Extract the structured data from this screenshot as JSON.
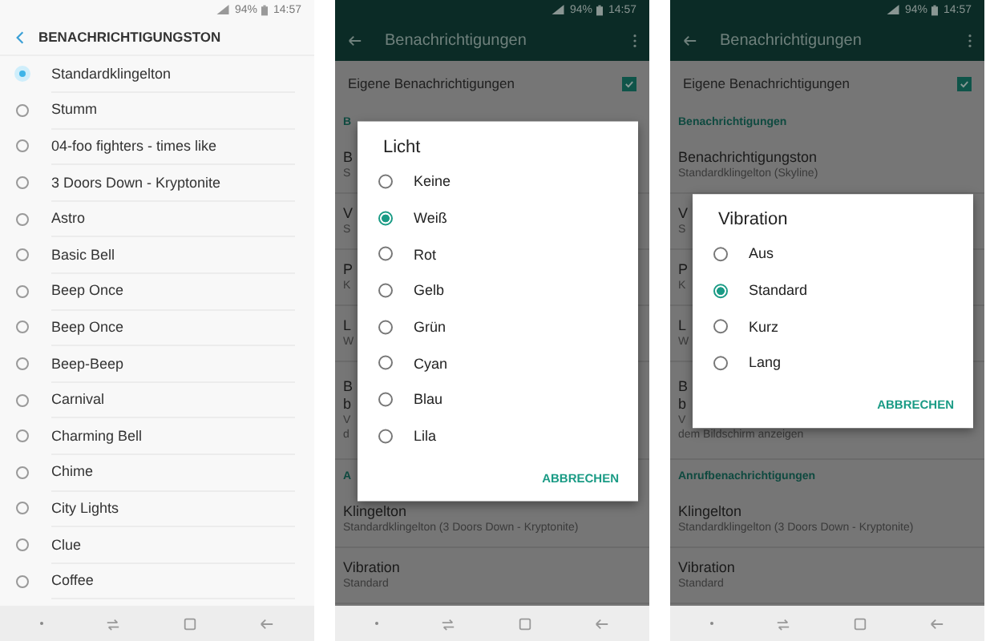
{
  "phones": [
    {
      "kind": "ringtone_list",
      "status": {
        "battery": "94%",
        "time": "14:57"
      },
      "title": "BENACHRICHTIGUNGSTON",
      "options": [
        {
          "label": "Standardklingelton",
          "selected": true
        },
        {
          "label": "Stumm",
          "selected": false
        },
        {
          "label": "04-foo fighters - times like",
          "selected": false
        },
        {
          "label": "3 Doors Down - Kryptonite",
          "selected": false
        },
        {
          "label": "Astro",
          "selected": false
        },
        {
          "label": "Basic Bell",
          "selected": false
        },
        {
          "label": "Beep Once",
          "selected": false
        },
        {
          "label": "Beep Once",
          "selected": false
        },
        {
          "label": "Beep-Beep",
          "selected": false
        },
        {
          "label": "Carnival",
          "selected": false
        },
        {
          "label": "Charming Bell",
          "selected": false
        },
        {
          "label": "Chime",
          "selected": false
        },
        {
          "label": "City Lights",
          "selected": false
        },
        {
          "label": "Clue",
          "selected": false
        },
        {
          "label": "Coffee",
          "selected": false
        }
      ]
    },
    {
      "kind": "settings_dialog",
      "status": {
        "battery": "94%",
        "time": "14:57"
      },
      "title": "Benachrichtigungen",
      "custom": {
        "label": "Eigene Benachrichtigungen",
        "checked": true
      },
      "rows": [
        {
          "kind": "section",
          "text": "B"
        },
        {
          "kind": "item",
          "title_lines": [
            "B"
          ],
          "subtitle_lines": [
            "S"
          ]
        },
        {
          "kind": "item",
          "title_lines": [
            "V"
          ],
          "subtitle_lines": [
            "S"
          ]
        },
        {
          "kind": "item",
          "title_lines": [
            "P"
          ],
          "subtitle_lines": [
            "K"
          ]
        },
        {
          "kind": "item",
          "title_lines": [
            "L"
          ],
          "subtitle_lines": [
            "W"
          ]
        },
        {
          "kind": "item",
          "title_lines": [
            "B",
            "b"
          ],
          "subtitle_lines": [
            "V",
            "d"
          ]
        },
        {
          "kind": "section",
          "text": "A"
        },
        {
          "kind": "item",
          "title_lines": [
            "Klingelton"
          ],
          "subtitle_lines": [
            "Standardklingelton (3 Doors Down - Kryptonite)"
          ]
        },
        {
          "kind": "item",
          "title_lines": [
            "Vibration"
          ],
          "subtitle_lines": [
            "Standard"
          ]
        }
      ],
      "dialog": {
        "title": "Licht",
        "options": [
          {
            "label": "Keine",
            "selected": false
          },
          {
            "label": "Weiß",
            "selected": true
          },
          {
            "label": "Rot",
            "selected": false
          },
          {
            "label": "Gelb",
            "selected": false
          },
          {
            "label": "Grün",
            "selected": false
          },
          {
            "label": "Cyan",
            "selected": false
          },
          {
            "label": "Blau",
            "selected": false
          },
          {
            "label": "Lila",
            "selected": false
          }
        ],
        "cancel": "ABBRECHEN"
      }
    },
    {
      "kind": "settings_dialog",
      "status": {
        "battery": "94%",
        "time": "14:57"
      },
      "title": "Benachrichtigungen",
      "custom": {
        "label": "Eigene Benachrichtigungen",
        "checked": true
      },
      "rows": [
        {
          "kind": "section",
          "text": "Benachrichtigungen"
        },
        {
          "kind": "item",
          "title_lines": [
            "Benachrichtigungston"
          ],
          "subtitle_lines": [
            "Standardklingelton (Skyline)"
          ]
        },
        {
          "kind": "item",
          "title_lines": [
            "V"
          ],
          "subtitle_lines": [
            "S"
          ]
        },
        {
          "kind": "item",
          "title_lines": [
            "P"
          ],
          "subtitle_lines": [
            "K"
          ]
        },
        {
          "kind": "item",
          "title_lines": [
            "L"
          ],
          "subtitle_lines": [
            "W"
          ]
        },
        {
          "kind": "item",
          "title_lines": [
            "B",
            "b"
          ],
          "subtitle_lines": [
            "V",
            "dem Bildschirm anzeigen"
          ]
        },
        {
          "kind": "section",
          "text": "Anrufbenachrichtigungen"
        },
        {
          "kind": "item",
          "title_lines": [
            "Klingelton"
          ],
          "subtitle_lines": [
            "Standardklingelton (3 Doors Down - Kryptonite)"
          ]
        },
        {
          "kind": "item",
          "title_lines": [
            "Vibration"
          ],
          "subtitle_lines": [
            "Standard"
          ]
        }
      ],
      "dialog": {
        "title": "Vibration",
        "options": [
          {
            "label": "Aus",
            "selected": false
          },
          {
            "label": "Standard",
            "selected": true
          },
          {
            "label": "Kurz",
            "selected": false
          },
          {
            "label": "Lang",
            "selected": false
          }
        ],
        "cancel": "ABBRECHEN"
      }
    }
  ]
}
